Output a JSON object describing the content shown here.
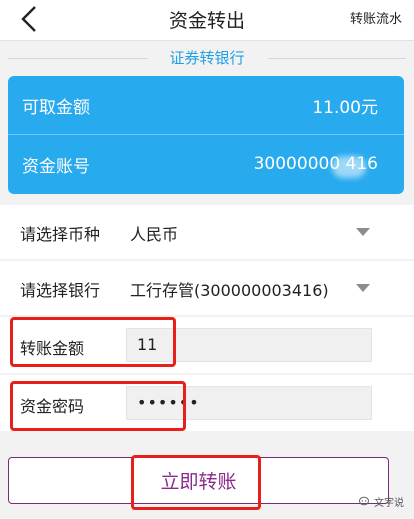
{
  "header": {
    "title": "资金转出",
    "history_link": "转账流水"
  },
  "section": {
    "label": "证券转银行"
  },
  "account_card": {
    "available_label": "可取金额",
    "available_value": "11.00元",
    "account_label": "资金账号",
    "account_value": "30000000 416"
  },
  "form": {
    "currency_label": "请选择币种",
    "currency_value": "人民币",
    "bank_label": "请选择银行",
    "bank_value": "工行存管(300000003416)",
    "amount_label": "转账金额",
    "amount_value": "11",
    "password_label": "资金密码",
    "password_value": "••••••"
  },
  "submit": {
    "label": "立即转账"
  },
  "watermark": {
    "text": "文字说"
  },
  "colors": {
    "accent_blue": "#28aaee",
    "highlight_red": "#e8201c",
    "button_purple": "#8a2a8a"
  }
}
